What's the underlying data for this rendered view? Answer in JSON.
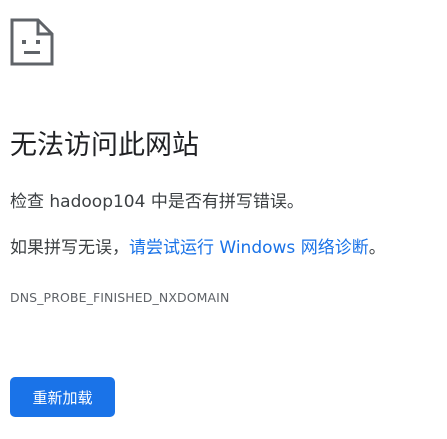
{
  "icon": {
    "name": "sad-document-icon"
  },
  "error": {
    "title": "无法访问此网站",
    "check_prefix": "检查 ",
    "host": "hadoop104",
    "check_suffix": " 中是否有拼写错误。",
    "suggest_prefix": "如果拼写无误，",
    "suggest_link": "请尝试运行 Windows 网络诊断",
    "suggest_suffix": "。",
    "code": "DNS_PROBE_FINISHED_NXDOMAIN"
  },
  "actions": {
    "reload_label": "重新加载"
  },
  "colors": {
    "accent": "#1a73e8",
    "text": "#202124",
    "muted": "#5f6368"
  }
}
